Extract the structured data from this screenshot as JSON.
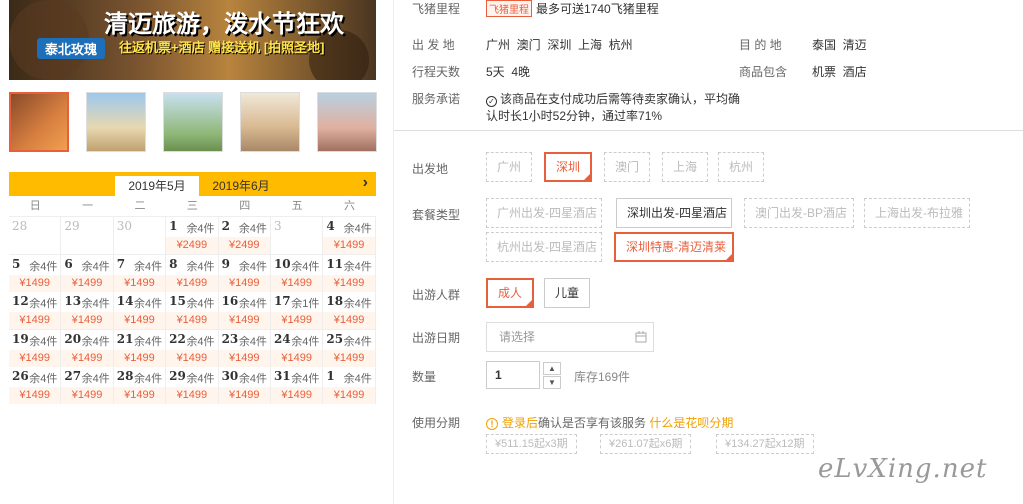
{
  "banner": {
    "title": "清迈旅游，泼水节狂欢",
    "tag": "泰北玫瑰",
    "promo": "往返机票+酒店 赠接送机 [拍照圣地]"
  },
  "thumbnails": [
    "thumb-1",
    "thumb-2",
    "thumb-3",
    "thumb-4",
    "thumb-5"
  ],
  "calendar": {
    "tabs": [
      "2019年5月",
      "2019年6月"
    ],
    "next_icon": "›",
    "weekdays": [
      "日",
      "一",
      "二",
      "三",
      "四",
      "五",
      "六"
    ],
    "weeks": [
      [
        {
          "d": "28",
          "s": "",
          "p": "",
          "dim": true
        },
        {
          "d": "29",
          "s": "",
          "p": "",
          "dim": true
        },
        {
          "d": "30",
          "s": "",
          "p": "",
          "dim": true
        },
        {
          "d": "1",
          "s": "余4件",
          "p": "¥2499"
        },
        {
          "d": "2",
          "s": "余4件",
          "p": "¥2499"
        },
        {
          "d": "3",
          "s": "",
          "p": "",
          "dim": true
        },
        {
          "d": "4",
          "s": "余4件",
          "p": "¥1499"
        }
      ],
      [
        {
          "d": "5",
          "s": "余4件",
          "p": "¥1499"
        },
        {
          "d": "6",
          "s": "余4件",
          "p": "¥1499"
        },
        {
          "d": "7",
          "s": "余4件",
          "p": "¥1499"
        },
        {
          "d": "8",
          "s": "余4件",
          "p": "¥1499"
        },
        {
          "d": "9",
          "s": "余4件",
          "p": "¥1499"
        },
        {
          "d": "10",
          "s": "余4件",
          "p": "¥1499"
        },
        {
          "d": "11",
          "s": "余4件",
          "p": "¥1499"
        }
      ],
      [
        {
          "d": "12",
          "s": "余4件",
          "p": "¥1499"
        },
        {
          "d": "13",
          "s": "余4件",
          "p": "¥1499"
        },
        {
          "d": "14",
          "s": "余4件",
          "p": "¥1499"
        },
        {
          "d": "15",
          "s": "余4件",
          "p": "¥1499"
        },
        {
          "d": "16",
          "s": "余4件",
          "p": "¥1499"
        },
        {
          "d": "17",
          "s": "余1件",
          "p": "¥1499"
        },
        {
          "d": "18",
          "s": "余4件",
          "p": "¥1499"
        }
      ],
      [
        {
          "d": "19",
          "s": "余4件",
          "p": "¥1499"
        },
        {
          "d": "20",
          "s": "余4件",
          "p": "¥1499"
        },
        {
          "d": "21",
          "s": "余4件",
          "p": "¥1499"
        },
        {
          "d": "22",
          "s": "余4件",
          "p": "¥1499"
        },
        {
          "d": "23",
          "s": "余4件",
          "p": "¥1499"
        },
        {
          "d": "24",
          "s": "余4件",
          "p": "¥1499"
        },
        {
          "d": "25",
          "s": "余4件",
          "p": "¥1499"
        }
      ],
      [
        {
          "d": "26",
          "s": "余4件",
          "p": "¥1499"
        },
        {
          "d": "27",
          "s": "余4件",
          "p": "¥1499"
        },
        {
          "d": "28",
          "s": "余4件",
          "p": "¥1499"
        },
        {
          "d": "29",
          "s": "余4件",
          "p": "¥1499"
        },
        {
          "d": "30",
          "s": "余4件",
          "p": "¥1499"
        },
        {
          "d": "31",
          "s": "余4件",
          "p": "¥1499"
        },
        {
          "d": "1",
          "s": "余4件",
          "p": "¥1499"
        }
      ]
    ]
  },
  "info": {
    "miles_label": "飞猪里程",
    "miles_tag": "飞猪里程",
    "miles_text": "最多可送1740飞猪里程",
    "depart_label": "出 发 地",
    "depart_value": "广州  澳门  深圳  上海  杭州",
    "dest_label": "目 的 地",
    "dest_value": "泰国  清迈",
    "days_label": "行程天数",
    "days_value": "5天  4晚",
    "includes_label": "商品包含",
    "includes_value": "机票  酒店",
    "service_label": "服务承诺",
    "service_line1": "该商品在支付成功后需等待卖家确认，平均确",
    "service_line2": "认时长1小时52分钟，通过率71%"
  },
  "options": {
    "city_label": "出发地",
    "cities": [
      "广州",
      "深圳",
      "澳门",
      "上海",
      "杭州"
    ],
    "package_label": "套餐类型",
    "packages": [
      "广州出发-四星酒店",
      "深圳出发-四星酒店",
      "澳门出发-BP酒店",
      "上海出发-布拉雅",
      "杭州出发-四星酒店",
      "深圳特惠-清迈清莱"
    ],
    "people_label": "出游人群",
    "people": [
      "成人",
      "儿童"
    ],
    "date_label": "出游日期",
    "date_placeholder": "请选择",
    "qty_label": "数量",
    "qty_value": "1",
    "stock": "库存169件",
    "install_label": "使用分期",
    "install_link1": "登录后",
    "install_text": "确认是否享有该服务",
    "install_link2": "什么是花呗分期",
    "installments": [
      "¥511.15起x3期",
      "¥261.07起x6期",
      "¥134.27起x12期"
    ]
  },
  "watermark": "eLvXing.net"
}
